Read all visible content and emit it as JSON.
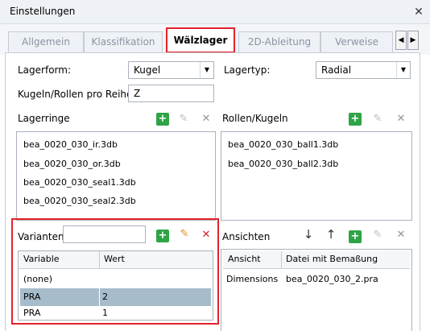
{
  "window": {
    "title": "Einstellungen",
    "close_symbol": "✕"
  },
  "tabs": [
    {
      "label": "Allgemein"
    },
    {
      "label": "Klassifikation"
    },
    {
      "label": "Wälzlager"
    },
    {
      "label": "2D-Ableitung"
    },
    {
      "label": "Verweise"
    }
  ],
  "form": {
    "lagerform_label": "Lagerform:",
    "lagerform_value": "Kugel",
    "lagertyp_label": "Lagertyp:",
    "lagertyp_value": "Radial",
    "kugeln_label": "Kugeln/Rollen pro Reihe:",
    "kugeln_value": "Z"
  },
  "lagerringe": {
    "label": "Lagerringe",
    "items": [
      "bea_0020_030_ir.3db",
      "bea_0020_030_or.3db",
      "bea_0020_030_seal1.3db",
      "bea_0020_030_seal2.3db"
    ]
  },
  "rollen": {
    "label": "Rollen/Kugeln",
    "items": [
      "bea_0020_030_ball1.3db",
      "bea_0020_030_ball2.3db"
    ]
  },
  "varianten": {
    "label": "Varianten",
    "input_value": "",
    "columns": [
      "Variable",
      "Wert"
    ],
    "rows": [
      {
        "variable": "(none)",
        "wert": ""
      },
      {
        "variable": "PRA",
        "wert": "2"
      },
      {
        "variable": "PRA",
        "wert": "1"
      }
    ]
  },
  "ansichten": {
    "label": "Ansichten",
    "columns": [
      "Ansicht",
      "Datei mit Bemaßung"
    ],
    "rows": [
      {
        "ansicht": "Dimensions",
        "datei": "bea_0020_030_2.pra"
      }
    ]
  },
  "icons": {
    "add": "+",
    "edit": "✎",
    "delete": "✕",
    "down": "↓",
    "up": "↑",
    "combo_arrow": "▼",
    "scroll_left": "◀",
    "scroll_right": "▶"
  },
  "colors": {
    "highlight_red": "#e3222c",
    "selected_row": "#a6bccb",
    "add_green": "#2fa347"
  }
}
